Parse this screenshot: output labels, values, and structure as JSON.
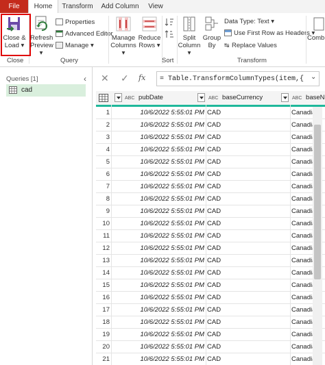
{
  "tabs": [
    "File",
    "Home",
    "Transform",
    "Add Column",
    "View"
  ],
  "ribbon": {
    "close_group": {
      "label": "Close",
      "close_load_line1": "Close &",
      "close_load_line2": "Load"
    },
    "query_group": {
      "label": "Query",
      "refresh_line1": "Refresh",
      "refresh_line2": "Preview",
      "properties": "Properties",
      "advanced_editor": "Advanced Editor",
      "manage": "Manage"
    },
    "manage_columns": {
      "line1": "Manage",
      "line2": "Columns"
    },
    "reduce_rows": {
      "line1": "Reduce",
      "line2": "Rows"
    },
    "sort_group": {
      "label": "Sort"
    },
    "transform_group": {
      "label": "Transform",
      "split_line1": "Split",
      "split_line2": "Column",
      "group_line1": "Group",
      "group_line2": "By",
      "data_type": "Data Type: Text",
      "first_row": "Use First Row as Headers",
      "replace": "Replace Values"
    },
    "combine": "Combi"
  },
  "queries_pane": {
    "title": "Queries [1]",
    "items": [
      "cad"
    ]
  },
  "formula": {
    "fx": "fx",
    "text": "= Table.TransformColumnTypes(item,{"
  },
  "grid": {
    "columns": [
      {
        "type_icon": "ABC",
        "name": "pubDate"
      },
      {
        "type_icon": "ABC",
        "name": "baseCurrency"
      },
      {
        "type_icon": "ABC",
        "name": "baseNa"
      }
    ],
    "rows": [
      {
        "i": "1",
        "date": "10/6/2022 5:55:01 PM",
        "cur": "CAD",
        "name": "Canadian"
      },
      {
        "i": "2",
        "date": "10/6/2022 5:55:01 PM",
        "cur": "CAD",
        "name": "Canadian"
      },
      {
        "i": "3",
        "date": "10/6/2022 5:55:01 PM",
        "cur": "CAD",
        "name": "Canadian"
      },
      {
        "i": "4",
        "date": "10/6/2022 5:55:01 PM",
        "cur": "CAD",
        "name": "Canadian"
      },
      {
        "i": "5",
        "date": "10/6/2022 5:55:01 PM",
        "cur": "CAD",
        "name": "Canadian"
      },
      {
        "i": "6",
        "date": "10/6/2022 5:55:01 PM",
        "cur": "CAD",
        "name": "Canadian"
      },
      {
        "i": "7",
        "date": "10/6/2022 5:55:01 PM",
        "cur": "CAD",
        "name": "Canadian"
      },
      {
        "i": "8",
        "date": "10/6/2022 5:55:01 PM",
        "cur": "CAD",
        "name": "Canadian"
      },
      {
        "i": "9",
        "date": "10/6/2022 5:55:01 PM",
        "cur": "CAD",
        "name": "Canadian"
      },
      {
        "i": "10",
        "date": "10/6/2022 5:55:01 PM",
        "cur": "CAD",
        "name": "Canadian"
      },
      {
        "i": "11",
        "date": "10/6/2022 5:55:01 PM",
        "cur": "CAD",
        "name": "Canadian"
      },
      {
        "i": "12",
        "date": "10/6/2022 5:55:01 PM",
        "cur": "CAD",
        "name": "Canadian"
      },
      {
        "i": "13",
        "date": "10/6/2022 5:55:01 PM",
        "cur": "CAD",
        "name": "Canadian"
      },
      {
        "i": "14",
        "date": "10/6/2022 5:55:01 PM",
        "cur": "CAD",
        "name": "Canadian"
      },
      {
        "i": "15",
        "date": "10/6/2022 5:55:01 PM",
        "cur": "CAD",
        "name": "Canadian"
      },
      {
        "i": "16",
        "date": "10/6/2022 5:55:01 PM",
        "cur": "CAD",
        "name": "Canadian"
      },
      {
        "i": "17",
        "date": "10/6/2022 5:55:01 PM",
        "cur": "CAD",
        "name": "Canadian"
      },
      {
        "i": "18",
        "date": "10/6/2022 5:55:01 PM",
        "cur": "CAD",
        "name": "Canadian"
      },
      {
        "i": "19",
        "date": "10/6/2022 5:55:01 PM",
        "cur": "CAD",
        "name": "Canadian"
      },
      {
        "i": "20",
        "date": "10/6/2022 5:55:01 PM",
        "cur": "CAD",
        "name": "Canadian"
      },
      {
        "i": "21",
        "date": "10/6/2022 5:55:01 PM",
        "cur": "CAD",
        "name": "Canadian"
      }
    ]
  },
  "colors": {
    "file_tab": "#c42b1c",
    "highlight": "#e00000",
    "header_accent": "#1fb89b",
    "query_selected": "#d9efdd"
  }
}
